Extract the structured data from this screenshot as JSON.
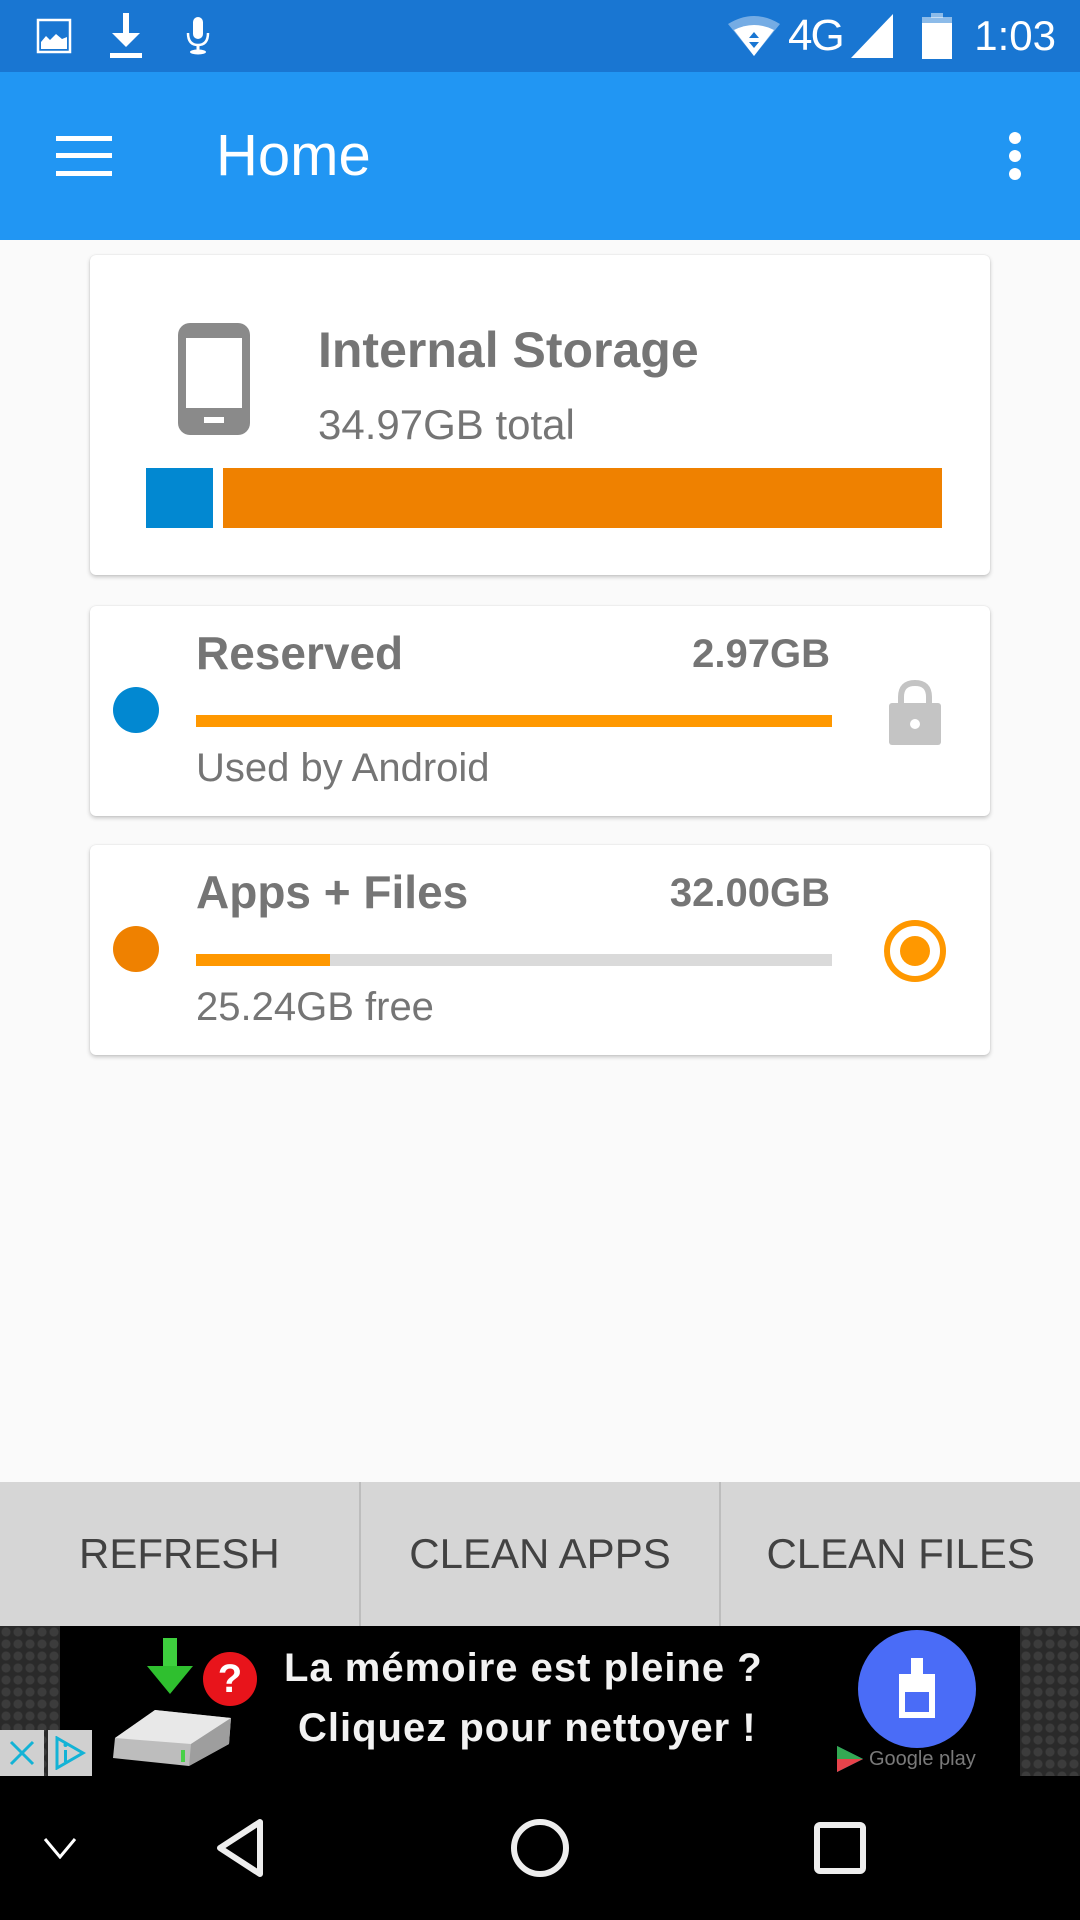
{
  "status_bar": {
    "left_icons": [
      "image-icon",
      "download-icon",
      "microphone-icon"
    ],
    "right_icons": [
      "wifi-icon",
      "signal-icon",
      "battery-icon"
    ],
    "network": "4G",
    "time": "1:03"
  },
  "toolbar": {
    "menu_icon": "hamburger-menu-icon",
    "title": "Home",
    "overflow_icon": "more-vert-icon"
  },
  "storage": {
    "icon": "phone-icon",
    "title": "Internal Storage",
    "total": "34.97GB total",
    "breakdown": [
      {
        "name": "Reserved",
        "value_gb": 2.97,
        "color": "#0288d1"
      },
      {
        "name": "Apps + Files",
        "value_gb": 32.0,
        "color": "#ef8100"
      }
    ]
  },
  "cards": [
    {
      "title": "Reserved",
      "size": "2.97GB",
      "subtitle": "Used by Android",
      "dot_color": "#0288d1",
      "usage_fraction": 1.0,
      "action_icon": "lock-icon"
    },
    {
      "title": "Apps + Files",
      "size": "32.00GB",
      "subtitle": "25.24GB free",
      "dot_color": "#ef8100",
      "usage_fraction": 0.21,
      "action_icon": "radio-selected-icon"
    }
  ],
  "colors": {
    "status_bar": "#1976d2",
    "toolbar": "#2196f3",
    "accent_orange": "#ff9800",
    "reserved_blue": "#0288d1"
  },
  "buttons": {
    "refresh": "REFRESH",
    "clean_apps": "CLEAN APPS",
    "clean_files": "CLEAN FILES"
  },
  "ad": {
    "line1": "La mémoire est pleine ?",
    "line2": "Cliquez pour nettoyer !",
    "question_mark": "?",
    "store_label": "Google play",
    "close_icon": "ad-close-icon",
    "info_icon": "ad-choices-icon"
  },
  "nav_bar": {
    "icons": [
      "chevron-down-icon",
      "back-icon",
      "home-icon",
      "recents-icon"
    ]
  }
}
